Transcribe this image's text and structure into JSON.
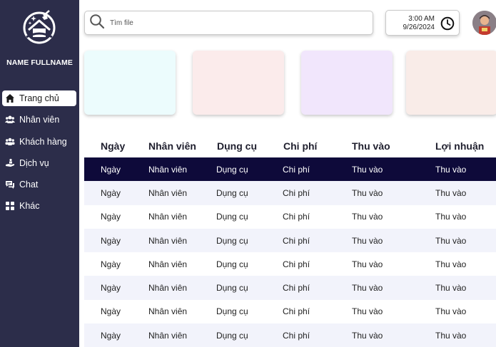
{
  "user": {
    "name": "NAME FULLNAME"
  },
  "nav": [
    {
      "label": "Trang chủ",
      "icon": "home-icon",
      "active": true
    },
    {
      "label": "Nhân viên",
      "icon": "staff-icon",
      "active": false
    },
    {
      "label": "Khách hàng",
      "icon": "customers-icon",
      "active": false
    },
    {
      "label": "Dịch vụ",
      "icon": "service-icon",
      "active": false
    },
    {
      "label": "Chat",
      "icon": "chat-icon",
      "active": false
    },
    {
      "label": "Khác",
      "icon": "grid-icon",
      "active": false
    }
  ],
  "search": {
    "placeholder": "Tìm file",
    "icon": "search-icon"
  },
  "clock": {
    "time": "3:00 AM",
    "date": "9/26/2024",
    "icon": "clock-icon"
  },
  "cards": [
    {
      "color": "#ecfcfd"
    },
    {
      "color": "#fbebeb"
    },
    {
      "color": "#f1e6fc"
    },
    {
      "color": "#f9ece8"
    }
  ],
  "table": {
    "headers": [
      "Ngày",
      "Nhân viên",
      "Dụng cụ",
      "Chi phí",
      "Thu vào",
      "Lợi nhuận"
    ],
    "rows": [
      [
        "Ngày",
        "Nhân viên",
        "Dụng cụ",
        "Chi phí",
        "Thu vào",
        "Thu vào"
      ],
      [
        "Ngày",
        "Nhân viên",
        "Dụng cụ",
        "Chi phí",
        "Thu vào",
        "Thu vào"
      ],
      [
        "Ngày",
        "Nhân viên",
        "Dụng cụ",
        "Chi phí",
        "Thu vào",
        "Thu vào"
      ],
      [
        "Ngày",
        "Nhân viên",
        "Dụng cụ",
        "Chi phí",
        "Thu vào",
        "Thu vào"
      ],
      [
        "Ngày",
        "Nhân viên",
        "Dụng cụ",
        "Chi phí",
        "Thu vào",
        "Thu vào"
      ],
      [
        "Ngày",
        "Nhân viên",
        "Dụng cụ",
        "Chi phí",
        "Thu vào",
        "Thu vào"
      ],
      [
        "Ngày",
        "Nhân viên",
        "Dụng cụ",
        "Chi phí",
        "Thu vào",
        "Thu vào"
      ],
      [
        "Ngày",
        "Nhân viên",
        "Dụng cụ",
        "Chi phí",
        "Thu vào",
        "Thu vào"
      ]
    ]
  },
  "colors": {
    "sidebar": "#2c2d4a",
    "highlight_row": "#0e0a3a",
    "alt_row": "#f2f3fb"
  }
}
